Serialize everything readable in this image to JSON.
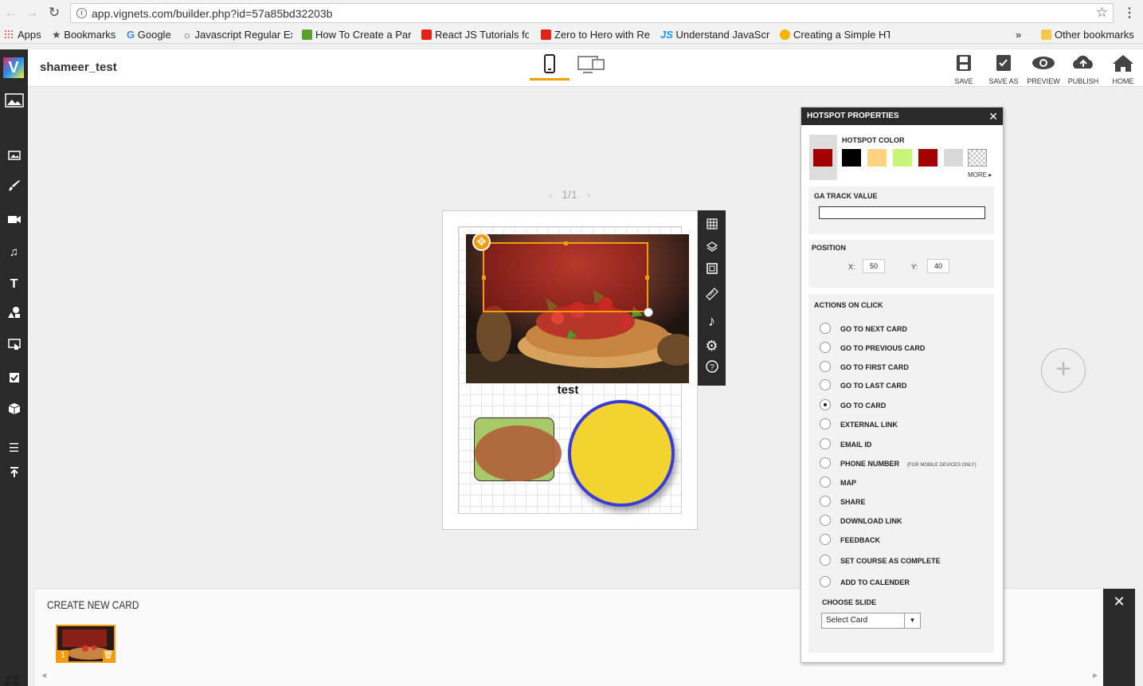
{
  "browser": {
    "url": "app.vignets.com/builder.php?id=57a85bd32203b",
    "bookmarks": [
      {
        "label": "Apps",
        "icon": "apps-grid-icon"
      },
      {
        "label": "Bookmarks",
        "icon": "star-icon"
      },
      {
        "label": "Google",
        "icon": "google-icon"
      },
      {
        "label": "Javascript Regular Exp",
        "icon": "regex-icon"
      },
      {
        "label": "How To Create a Para",
        "icon": "w3-icon"
      },
      {
        "label": "React JS Tutorials for",
        "icon": "youtube-icon"
      },
      {
        "label": "Zero to Hero with Re",
        "icon": "youtube-icon"
      },
      {
        "label": "Understand JavaScrip",
        "icon": "js-icon"
      },
      {
        "label": "Creating a Simple HT",
        "icon": "page-icon"
      }
    ],
    "overflow": "»",
    "other_bookmarks": "Other bookmarks"
  },
  "app": {
    "project_name": "shameer_test",
    "actions": {
      "save": "SAVE",
      "save_as": "SAVE AS",
      "preview": "PREVIEW",
      "publish": "PUBLISH",
      "home": "HOME"
    }
  },
  "canvas": {
    "pager": "1/1",
    "card_title": "test",
    "pager_prev": "‹",
    "pager_next": "›",
    "add_card": "+"
  },
  "bottom": {
    "create_new_card": "CREATE NEW CARD",
    "thumb_number": "1"
  },
  "hotspot_props": {
    "title": "HOTSPOT PROPERTIES",
    "color_label": "HOTSPOT COLOR",
    "current_color": "#a30000",
    "swatches": [
      "#000000",
      "#ffd27f",
      "#c6f578",
      "#a30000",
      "#d8d8d8",
      "transparent"
    ],
    "more_label": "MORE",
    "ga_label": "GA TRACK VALUE",
    "ga_value": "",
    "position_label": "POSITION",
    "x_label": "X:",
    "x_value": "50",
    "y_label": "Y:",
    "y_value": "40",
    "actions_label": "ACTIONS ON CLICK",
    "actions": [
      {
        "label": "GO TO NEXT  CARD",
        "selected": false,
        "note": ""
      },
      {
        "label": "GO TO PREVIOUS CARD",
        "selected": false,
        "note": ""
      },
      {
        "label": "GO TO FIRST CARD",
        "selected": false,
        "note": ""
      },
      {
        "label": "GO TO LAST CARD",
        "selected": false,
        "note": ""
      },
      {
        "label": "GO TO CARD",
        "selected": true,
        "note": ""
      },
      {
        "label": "EXTERNAL LINK",
        "selected": false,
        "note": ""
      },
      {
        "label": "EMAIL ID",
        "selected": false,
        "note": ""
      },
      {
        "label": "PHONE NUMBER",
        "selected": false,
        "note": "(FOR MOBILE DEVICES ONLY)"
      },
      {
        "label": "MAP",
        "selected": false,
        "note": ""
      },
      {
        "label": "SHARE",
        "selected": false,
        "note": ""
      },
      {
        "label": "DOWNLOAD LINK",
        "selected": false,
        "note": ""
      },
      {
        "label": "FEEDBACK",
        "selected": false,
        "note": ""
      },
      {
        "label": "SET COURSE AS COMPLETE",
        "selected": false,
        "note": ""
      },
      {
        "label": "ADD TO CALENDER",
        "selected": false,
        "note": ""
      }
    ],
    "choose_slide_label": "CHOOSE SLIDE",
    "choose_slide_value": "Select Card"
  },
  "colors": {
    "accent": "#f39c12",
    "toolbar_dark": "#2a2a2a",
    "ellipse_fill": "#b0623a",
    "rect_fill": "#a8c96a",
    "circle_fill": "#f2d430",
    "circle_stroke": "#3b3bd8"
  }
}
